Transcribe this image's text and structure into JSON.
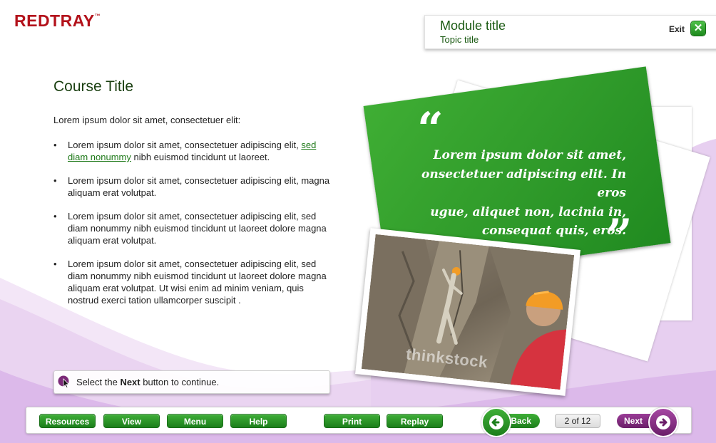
{
  "brand": {
    "logo": "REDTRAY",
    "trademark": "™"
  },
  "header": {
    "module_title": "Module title",
    "topic_title": "Topic title",
    "exit_label": "Exit",
    "exit_icon": "close-icon"
  },
  "content": {
    "course_title": "Course Title",
    "intro": "Lorem ipsum dolor sit amet, consectetuer elit:",
    "bullet1": {
      "text_before": "Lorem ipsum dolor sit amet, consectetuer adipiscing elit,",
      "link": "sed diam nonummy",
      "text_after": " nibh euismod tincidunt ut laoreet."
    },
    "bullet2": "Lorem ipsum dolor sit amet, consectetuer adipiscing elit, magna aliquam erat volutpat.",
    "bullet3": "Lorem ipsum dolor sit amet, consectetuer adipiscing elit, sed diam nonummy nibh euismod tincidunt ut laoreet dolore magna aliquam erat volutpat.",
    "bullet4": "Lorem ipsum dolor sit amet, consectetuer adipiscing elit, sed diam nonummy nibh euismod tincidunt ut laoreet dolore magna aliquam erat volutpat. Ut wisi enim ad minim veniam, quis nostrud exerci tation ullamcorper suscipit ."
  },
  "quote": {
    "open_mark": "“",
    "close_mark": "”",
    "line1": "Lorem ipsum dolor sit amet,",
    "line2": "onsectetuer adipiscing elit. In eros",
    "line3": "ugue, aliquet non, lacinia in,",
    "line4": "consequat quis, eros."
  },
  "photo": {
    "watermark": "thinkstock"
  },
  "instruction": {
    "prefix": "Select the ",
    "bold": "Next",
    "suffix": " button to continue."
  },
  "toolbar": {
    "resources": "Resources",
    "view": "View",
    "menu": "Menu",
    "help": "Help",
    "print": "Print",
    "replay": "Replay",
    "back": "Back",
    "page_indicator": "2 of 12",
    "next": "Next"
  },
  "colors": {
    "brand_red": "#b3121b",
    "accent_green": "#2f9a2a",
    "accent_purple": "#7b2a78",
    "wave_lilac": "#ecd8f2"
  }
}
